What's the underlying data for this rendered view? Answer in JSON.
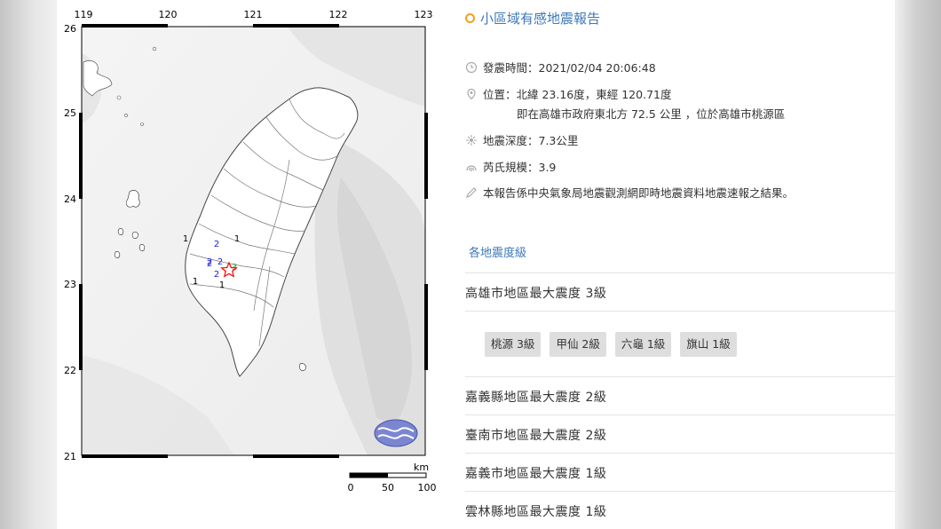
{
  "map": {
    "lon_ticks": [
      "119",
      "120",
      "121",
      "122",
      "123"
    ],
    "lat_ticks": [
      "26",
      "25",
      "24",
      "23",
      "22",
      "21"
    ],
    "scale_unit": "km",
    "scale_ticks": [
      "0",
      "50",
      "100"
    ],
    "intensity_markers": [
      {
        "label": "1",
        "color": "#000000"
      },
      {
        "label": "1",
        "color": "#000000"
      },
      {
        "label": "2",
        "color": "#2222cc"
      },
      {
        "label": "2",
        "color": "#2222cc"
      },
      {
        "label": "2",
        "color": "#2222cc"
      },
      {
        "label": "2",
        "color": "#2222cc"
      },
      {
        "label": "2",
        "color": "#2222cc"
      },
      {
        "label": "3",
        "color": "#22aa22"
      },
      {
        "label": "1",
        "color": "#000000"
      },
      {
        "label": "1",
        "color": "#000000"
      }
    ],
    "epicenter_color": "#ff0000"
  },
  "report": {
    "title": "小區域有感地震報告",
    "time": "發震時間：2021/02/04 20:06:48",
    "location": "位置：北緯 23.16度，東經 120.71度",
    "location_detail": "即在高雄市政府東北方 72.5 公里 ，位於高雄市桃源區",
    "depth": "地震深度：7.3公里",
    "magnitude": "芮氏規模：3.9",
    "note": "本報告係中央氣象局地震觀測網即時地震資料地震速報之結果。",
    "section_title": "各地震度級",
    "regions": [
      {
        "label": "高雄市地區最大震度 3級"
      },
      {
        "label": "嘉義縣地區最大震度 2級"
      },
      {
        "label": "臺南市地區最大震度 2級"
      },
      {
        "label": "嘉義市地區最大震度 1級"
      },
      {
        "label": "雲林縣地區最大震度 1級"
      }
    ],
    "stations": [
      "桃源 3級",
      "甲仙 2級",
      "六龜 1級",
      "旗山 1級"
    ]
  },
  "colors": {
    "accent": "#3d78b8",
    "title_dot": "#f0a020",
    "chip_bg": "#dedede"
  }
}
